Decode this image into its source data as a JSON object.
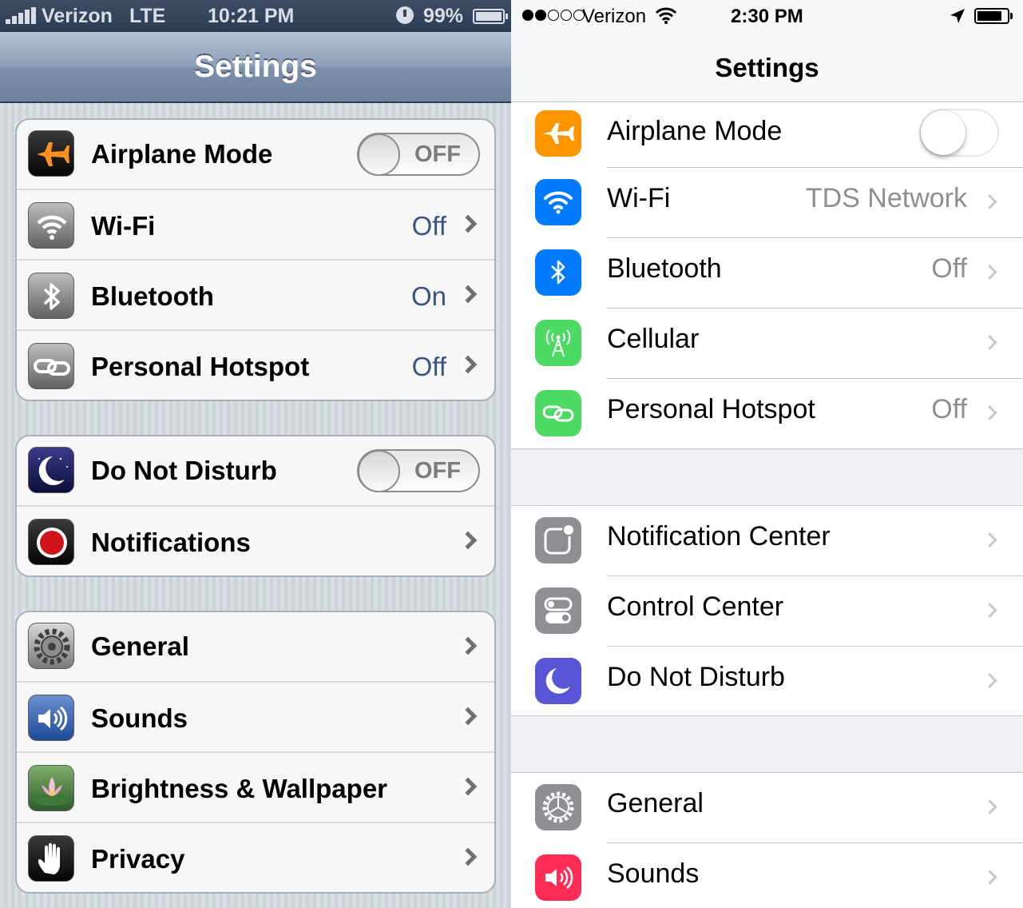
{
  "ios6": {
    "status_bar": {
      "carrier": "Verizon",
      "network": "LTE",
      "time": "10:21 PM",
      "battery": "99%"
    },
    "title": "Settings",
    "groups": [
      [
        {
          "label": "Airplane Mode",
          "icon": "airplane-icon",
          "toggle": "OFF"
        },
        {
          "label": "Wi-Fi",
          "icon": "wifi-icon",
          "value": "Off"
        },
        {
          "label": "Bluetooth",
          "icon": "bluetooth-icon",
          "value": "On"
        },
        {
          "label": "Personal Hotspot",
          "icon": "hotspot-icon",
          "value": "Off"
        }
      ],
      [
        {
          "label": "Do Not Disturb",
          "icon": "moon-icon",
          "toggle": "OFF"
        },
        {
          "label": "Notifications",
          "icon": "notifications-icon"
        }
      ],
      [
        {
          "label": "General",
          "icon": "gear-icon"
        },
        {
          "label": "Sounds",
          "icon": "speaker-icon"
        },
        {
          "label": "Brightness & Wallpaper",
          "icon": "lotus-icon"
        },
        {
          "label": "Privacy",
          "icon": "hand-icon"
        }
      ]
    ]
  },
  "ios7": {
    "status_bar": {
      "carrier": "Verizon",
      "time": "2:30 PM",
      "signal_bars_filled": 2,
      "signal_bars_total": 5
    },
    "title": "Settings",
    "sections": [
      [
        {
          "label": "Airplane Mode",
          "icon": "airplane-icon",
          "toggle": "off",
          "color": "#ff9500"
        },
        {
          "label": "Wi-Fi",
          "icon": "wifi-icon",
          "value": "TDS Network",
          "color": "#007aff"
        },
        {
          "label": "Bluetooth",
          "icon": "bluetooth-icon",
          "value": "Off",
          "color": "#007aff"
        },
        {
          "label": "Cellular",
          "icon": "cellular-icon",
          "color": "#4cd964"
        },
        {
          "label": "Personal Hotspot",
          "icon": "hotspot-icon",
          "value": "Off",
          "color": "#4cd964"
        }
      ],
      [
        {
          "label": "Notification Center",
          "icon": "notification-center-icon",
          "color": "#8e8e93"
        },
        {
          "label": "Control Center",
          "icon": "control-center-icon",
          "color": "#8e8e93"
        },
        {
          "label": "Do Not Disturb",
          "icon": "moon-icon",
          "color": "#5856d6"
        }
      ],
      [
        {
          "label": "General",
          "icon": "gear-icon",
          "color": "#8e8e93"
        },
        {
          "label": "Sounds",
          "icon": "speaker-icon",
          "color": "#ff2d55"
        }
      ]
    ]
  }
}
